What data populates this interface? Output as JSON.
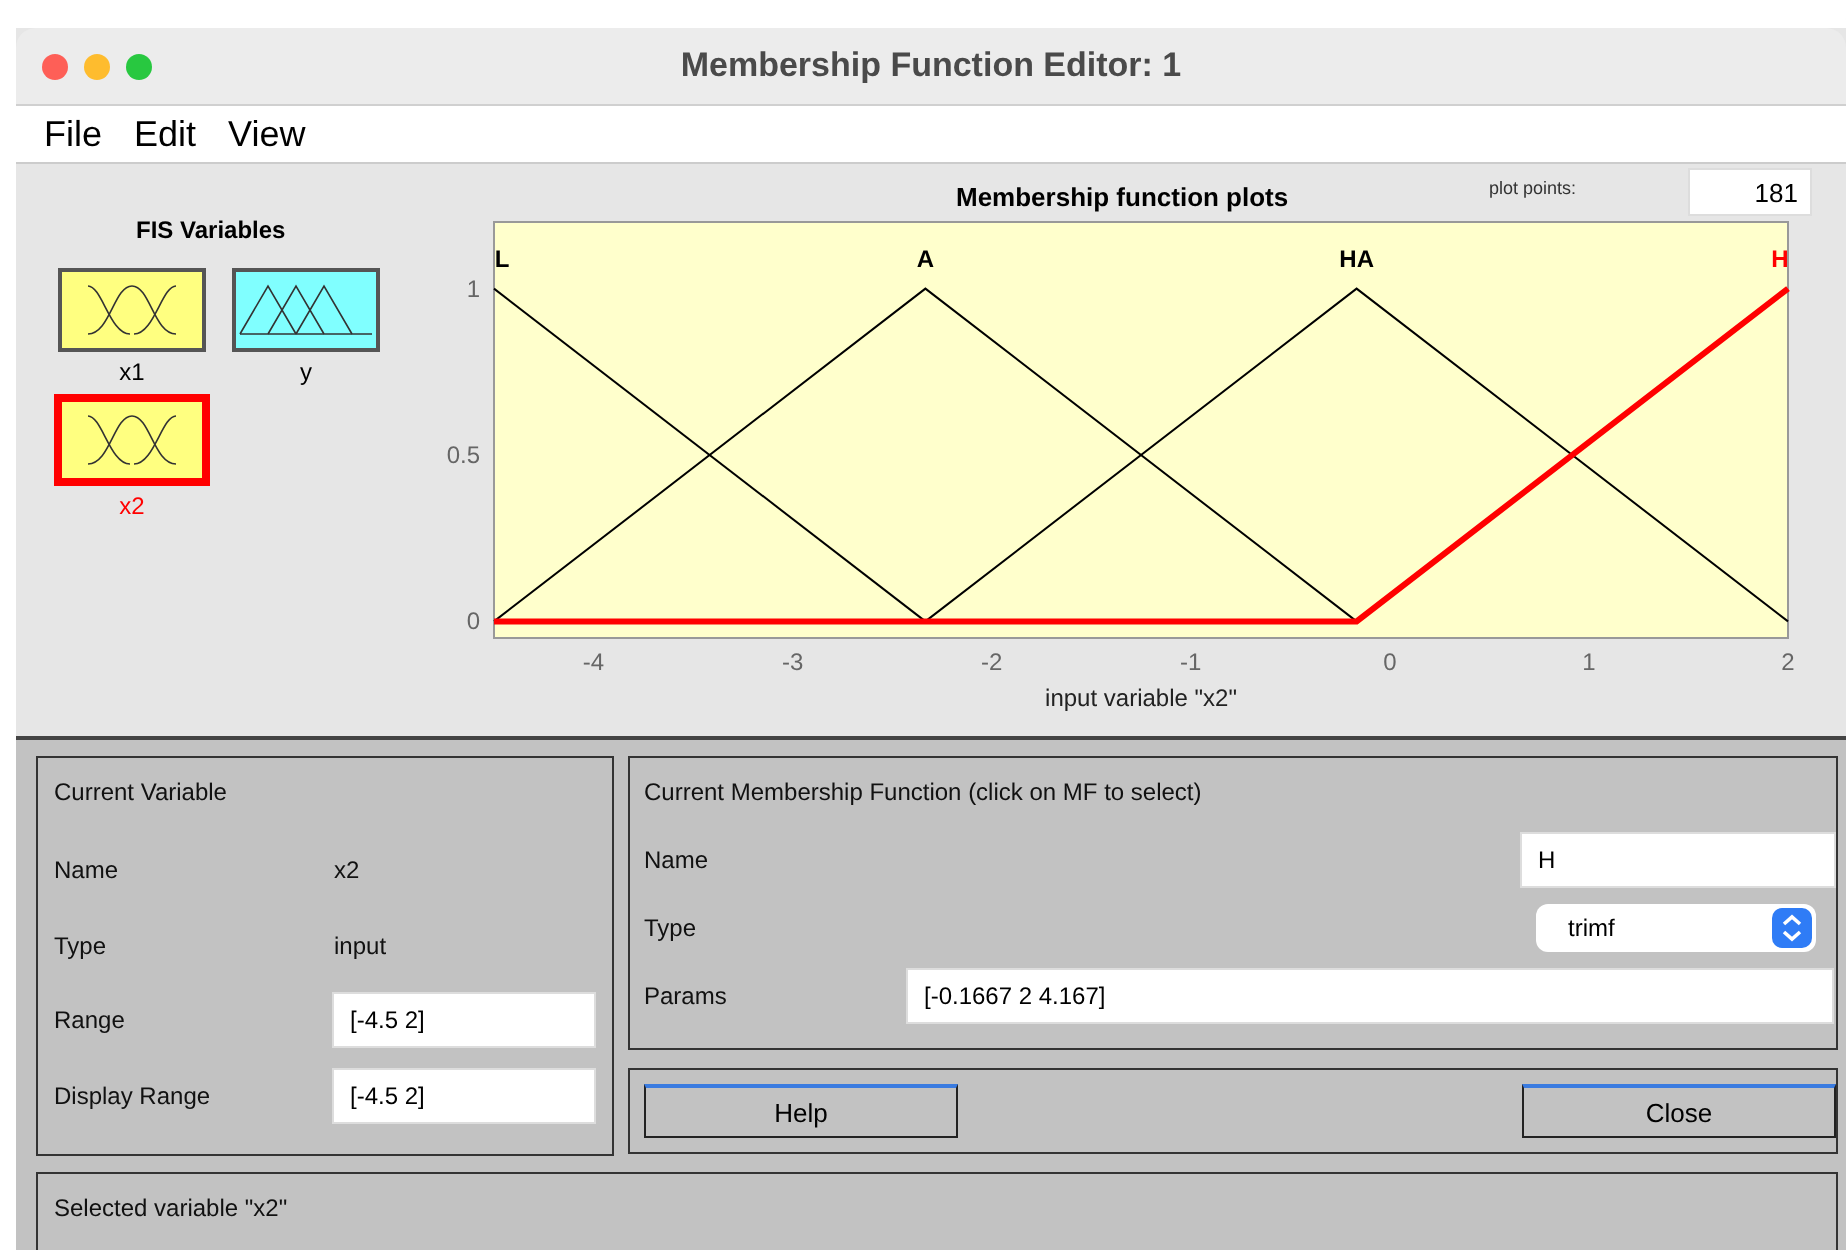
{
  "window": {
    "title": "Membership Function Editor: 1"
  },
  "menu": [
    "File",
    "Edit",
    "View"
  ],
  "fis_variables": {
    "title": "FIS Variables",
    "items": [
      {
        "name": "x1",
        "kind": "gaussian",
        "color": "#ffff80",
        "selected": false
      },
      {
        "name": "y",
        "kind": "triangle",
        "color": "#80ffff",
        "selected": false
      },
      {
        "name": "x2",
        "kind": "gaussian",
        "color": "#ffff80",
        "selected": true
      }
    ]
  },
  "plot_points": {
    "label": "plot points:",
    "value": "181"
  },
  "plot": {
    "chart_data": {
      "type": "line",
      "title": "Membership function plots",
      "xlabel": "input variable \"x2\"",
      "x": [
        -4.5,
        -2.3333,
        -0.1667,
        2
      ],
      "xlim": [
        -4.5,
        2
      ],
      "ylim": [
        -0.05,
        1.2
      ],
      "xticks": [
        -4,
        -3,
        -2,
        -1,
        0,
        1,
        2
      ],
      "yticks": [
        0,
        0.5,
        1
      ],
      "series": [
        {
          "name": "L",
          "color": "#000000",
          "values": [
            1,
            0,
            null,
            null
          ]
        },
        {
          "name": "A",
          "color": "#000000",
          "values": [
            0,
            1,
            0,
            null
          ]
        },
        {
          "name": "HA",
          "color": "#000000",
          "values": [
            null,
            0,
            1,
            0
          ]
        },
        {
          "name": "H",
          "color": "#ff0000",
          "values": [
            0,
            0,
            0,
            1
          ]
        }
      ]
    }
  },
  "current_variable": {
    "title": "Current Variable",
    "rows": [
      {
        "label": "Name",
        "value": "x2",
        "kind": "text"
      },
      {
        "label": "Type",
        "value": "input",
        "kind": "text"
      },
      {
        "label": "Range",
        "value": "[-4.5 2]",
        "kind": "field"
      },
      {
        "label": "Display Range",
        "value": "[-4.5 2]",
        "kind": "field"
      }
    ]
  },
  "current_mf": {
    "title": "Current Membership Function (click on MF to select)",
    "name_label": "Name",
    "name_value": "H",
    "type_label": "Type",
    "type_value": "trimf",
    "params_label": "Params",
    "params_value": "[-0.1667 2 4.167]"
  },
  "buttons": [
    "Help",
    "Close"
  ],
  "status": "Selected variable \"x2\""
}
